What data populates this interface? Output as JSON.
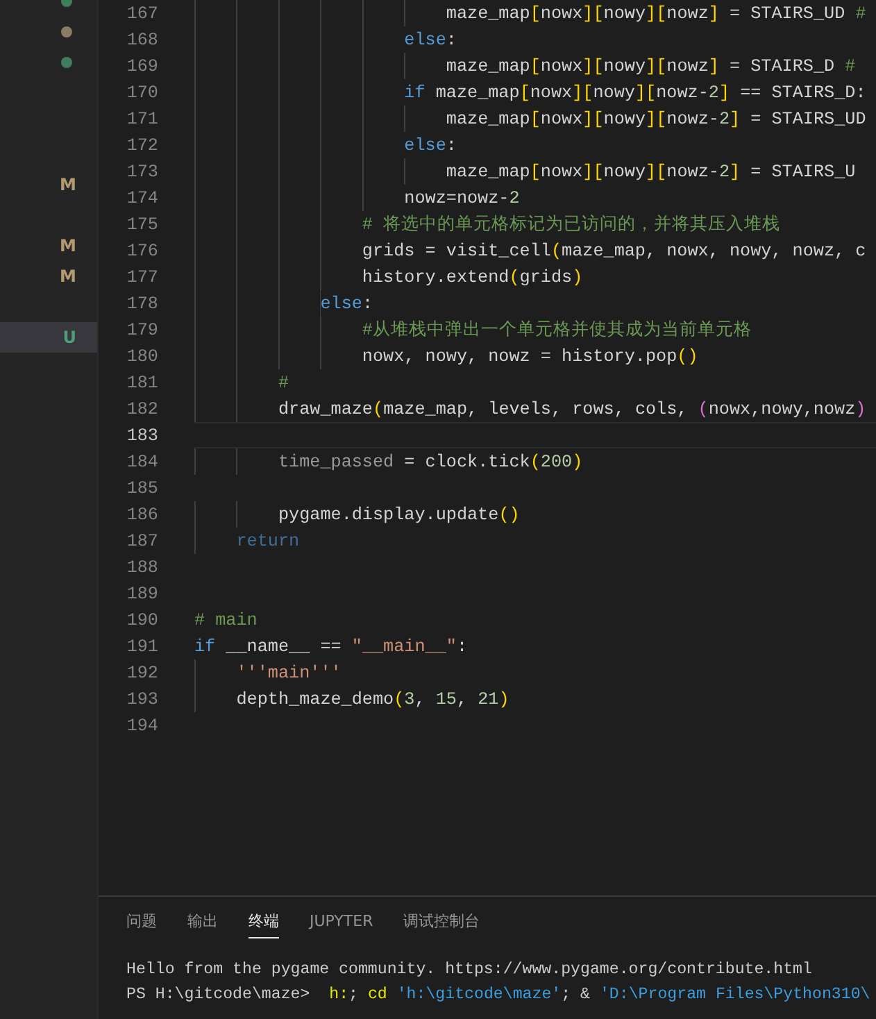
{
  "sidebar": {
    "rows": [
      {
        "kind": "dot",
        "color": "#3f7d5d",
        "selected": false
      },
      {
        "kind": "dot",
        "color": "#8a7b62",
        "selected": false
      },
      {
        "kind": "dot",
        "color": "#3f7d5d",
        "selected": false
      },
      {
        "kind": "blank",
        "selected": false
      },
      {
        "kind": "blank",
        "selected": false
      },
      {
        "kind": "blank",
        "selected": false
      },
      {
        "kind": "letter",
        "text": "M",
        "color": "#b39a70",
        "selected": false
      },
      {
        "kind": "blank",
        "selected": false
      },
      {
        "kind": "letter",
        "text": "M",
        "color": "#b39a70",
        "selected": false
      },
      {
        "kind": "letter",
        "text": "M",
        "color": "#b39a70",
        "selected": false
      },
      {
        "kind": "blank",
        "selected": false
      },
      {
        "kind": "letter",
        "text": "U",
        "color": "#4f9e77",
        "selected": true
      }
    ]
  },
  "editor": {
    "lines": [
      {
        "number": "167",
        "current": false,
        "tokens": [
          {
            "kind": "plain",
            "text": "                        maze_map"
          },
          {
            "kind": "bracket",
            "text": "["
          },
          {
            "kind": "plain",
            "text": "nowx"
          },
          {
            "kind": "bracket",
            "text": "]["
          },
          {
            "kind": "plain",
            "text": "nowy"
          },
          {
            "kind": "bracket",
            "text": "]["
          },
          {
            "kind": "plain",
            "text": "nowz"
          },
          {
            "kind": "bracket",
            "text": "]"
          },
          {
            "kind": "plain",
            "text": " = STAIRS_UD "
          },
          {
            "kind": "comment",
            "text": "#"
          }
        ]
      },
      {
        "number": "168",
        "current": false,
        "tokens": [
          {
            "kind": "keyword",
            "text": "                    else"
          },
          {
            "kind": "plain",
            "text": ":"
          }
        ]
      },
      {
        "number": "169",
        "current": false,
        "tokens": [
          {
            "kind": "plain",
            "text": "                        maze_map"
          },
          {
            "kind": "bracket",
            "text": "["
          },
          {
            "kind": "plain",
            "text": "nowx"
          },
          {
            "kind": "bracket",
            "text": "]["
          },
          {
            "kind": "plain",
            "text": "nowy"
          },
          {
            "kind": "bracket",
            "text": "]["
          },
          {
            "kind": "plain",
            "text": "nowz"
          },
          {
            "kind": "bracket",
            "text": "]"
          },
          {
            "kind": "plain",
            "text": " = STAIRS_D "
          },
          {
            "kind": "comment",
            "text": "#"
          }
        ]
      },
      {
        "number": "170",
        "current": false,
        "tokens": [
          {
            "kind": "keyword",
            "text": "                    if"
          },
          {
            "kind": "plain",
            "text": " maze_map"
          },
          {
            "kind": "bracket",
            "text": "["
          },
          {
            "kind": "plain",
            "text": "nowx"
          },
          {
            "kind": "bracket",
            "text": "]["
          },
          {
            "kind": "plain",
            "text": "nowy"
          },
          {
            "kind": "bracket",
            "text": "]["
          },
          {
            "kind": "plain",
            "text": "nowz-"
          },
          {
            "kind": "number",
            "text": "2"
          },
          {
            "kind": "bracket",
            "text": "]"
          },
          {
            "kind": "plain",
            "text": " == STAIRS_D:"
          }
        ]
      },
      {
        "number": "171",
        "current": false,
        "tokens": [
          {
            "kind": "plain",
            "text": "                        maze_map"
          },
          {
            "kind": "bracket",
            "text": "["
          },
          {
            "kind": "plain",
            "text": "nowx"
          },
          {
            "kind": "bracket",
            "text": "]["
          },
          {
            "kind": "plain",
            "text": "nowy"
          },
          {
            "kind": "bracket",
            "text": "]["
          },
          {
            "kind": "plain",
            "text": "nowz-"
          },
          {
            "kind": "number",
            "text": "2"
          },
          {
            "kind": "bracket",
            "text": "]"
          },
          {
            "kind": "plain",
            "text": " = STAIRS_UD"
          }
        ]
      },
      {
        "number": "172",
        "current": false,
        "tokens": [
          {
            "kind": "keyword",
            "text": "                    else"
          },
          {
            "kind": "plain",
            "text": ":"
          }
        ]
      },
      {
        "number": "173",
        "current": false,
        "tokens": [
          {
            "kind": "plain",
            "text": "                        maze_map"
          },
          {
            "kind": "bracket",
            "text": "["
          },
          {
            "kind": "plain",
            "text": "nowx"
          },
          {
            "kind": "bracket",
            "text": "]["
          },
          {
            "kind": "plain",
            "text": "nowy"
          },
          {
            "kind": "bracket",
            "text": "]["
          },
          {
            "kind": "plain",
            "text": "nowz-"
          },
          {
            "kind": "number",
            "text": "2"
          },
          {
            "kind": "bracket",
            "text": "]"
          },
          {
            "kind": "plain",
            "text": " = STAIRS_U"
          }
        ]
      },
      {
        "number": "174",
        "current": false,
        "tokens": [
          {
            "kind": "plain",
            "text": "                    nowz=nowz-"
          },
          {
            "kind": "number",
            "text": "2"
          }
        ]
      },
      {
        "number": "175",
        "current": false,
        "tokens": [
          {
            "kind": "comment",
            "text": "                # 将选中的单元格标记为已访问的，并将其压入堆栈"
          }
        ]
      },
      {
        "number": "176",
        "current": false,
        "tokens": [
          {
            "kind": "plain",
            "text": "                grids = visit_cell"
          },
          {
            "kind": "bracket",
            "text": "("
          },
          {
            "kind": "plain",
            "text": "maze_map, nowx, nowy, nowz, c"
          }
        ]
      },
      {
        "number": "177",
        "current": false,
        "tokens": [
          {
            "kind": "plain",
            "text": "                history.extend"
          },
          {
            "kind": "bracket",
            "text": "("
          },
          {
            "kind": "plain",
            "text": "grids"
          },
          {
            "kind": "bracket",
            "text": ")"
          }
        ]
      },
      {
        "number": "178",
        "current": false,
        "tokens": [
          {
            "kind": "keyword",
            "text": "            else"
          },
          {
            "kind": "plain",
            "text": ":"
          }
        ]
      },
      {
        "number": "179",
        "current": false,
        "tokens": [
          {
            "kind": "comment",
            "text": "                #从堆栈中弹出一个单元格并使其成为当前单元格"
          }
        ]
      },
      {
        "number": "180",
        "current": false,
        "tokens": [
          {
            "kind": "plain",
            "text": "                nowx, nowy, nowz = history.pop"
          },
          {
            "kind": "bracket",
            "text": "()"
          }
        ]
      },
      {
        "number": "181",
        "current": false,
        "tokens": [
          {
            "kind": "comment",
            "text": "        #"
          }
        ]
      },
      {
        "number": "182",
        "current": false,
        "tokens": [
          {
            "kind": "plain",
            "text": "        draw_maze"
          },
          {
            "kind": "bracket",
            "text": "("
          },
          {
            "kind": "plain",
            "text": "maze_map, levels, rows, cols, "
          },
          {
            "kind": "bracket-inner",
            "text": "("
          },
          {
            "kind": "plain",
            "text": "nowx,nowy,nowz"
          },
          {
            "kind": "bracket-inner",
            "text": ")"
          }
        ]
      },
      {
        "number": "183",
        "current": true
      },
      {
        "number": "184",
        "current": false,
        "tokens": [
          {
            "kind": "unused",
            "text": "        time_passed"
          },
          {
            "kind": "plain",
            "text": " = clock.tick"
          },
          {
            "kind": "bracket",
            "text": "("
          },
          {
            "kind": "number",
            "text": "200"
          },
          {
            "kind": "bracket",
            "text": ")"
          }
        ]
      },
      {
        "number": "185",
        "current": false
      },
      {
        "number": "186",
        "current": false,
        "tokens": [
          {
            "kind": "plain",
            "text": "        pygame.display.update"
          },
          {
            "kind": "bracket",
            "text": "()"
          }
        ]
      },
      {
        "number": "187",
        "current": false,
        "tokens": [
          {
            "kind": "keyword-dim",
            "text": "    return"
          }
        ]
      },
      {
        "number": "188",
        "current": false
      },
      {
        "number": "189",
        "current": false
      },
      {
        "number": "190",
        "current": false,
        "tokens": [
          {
            "kind": "comment",
            "text": "# main"
          }
        ]
      },
      {
        "number": "191",
        "current": false,
        "tokens": [
          {
            "kind": "keyword",
            "text": "if"
          },
          {
            "kind": "plain",
            "text": " __name__ == "
          },
          {
            "kind": "string",
            "text": "\"__main__\""
          },
          {
            "kind": "plain",
            "text": ":"
          }
        ]
      },
      {
        "number": "192",
        "current": false,
        "tokens": [
          {
            "kind": "string",
            "text": "    '''main'''"
          }
        ]
      },
      {
        "number": "193",
        "current": false,
        "tokens": [
          {
            "kind": "plain",
            "text": "    depth_maze_demo"
          },
          {
            "kind": "bracket",
            "text": "("
          },
          {
            "kind": "number",
            "text": "3"
          },
          {
            "kind": "plain",
            "text": ", "
          },
          {
            "kind": "number",
            "text": "15"
          },
          {
            "kind": "plain",
            "text": ", "
          },
          {
            "kind": "number",
            "text": "21"
          },
          {
            "kind": "bracket",
            "text": ")"
          }
        ]
      },
      {
        "number": "194",
        "current": false
      }
    ]
  },
  "panel": {
    "tabs": [
      {
        "label": "问题",
        "selected": false
      },
      {
        "label": "输出",
        "selected": false
      },
      {
        "label": "终端",
        "selected": true
      },
      {
        "label": "JUPYTER",
        "selected": false
      },
      {
        "label": "调试控制台",
        "selected": false
      }
    ],
    "terminal": {
      "lines": [
        {
          "tokens": [
            {
              "kind": "plain",
              "text": "Hello from the pygame community. https://www.pygame.org/contribute.html"
            }
          ]
        },
        {
          "tokens": [
            {
              "kind": "plain",
              "text": "PS H:\\gitcode\\maze>  "
            },
            {
              "kind": "command",
              "text": "h:"
            },
            {
              "kind": "plain",
              "text": "; "
            },
            {
              "kind": "command",
              "text": "cd"
            },
            {
              "kind": "string",
              "text": " 'h:\\gitcode\\maze'"
            },
            {
              "kind": "plain",
              "text": "; & "
            },
            {
              "kind": "string",
              "text": "'D:\\Program Files\\Python310\\"
            }
          ]
        }
      ]
    }
  }
}
